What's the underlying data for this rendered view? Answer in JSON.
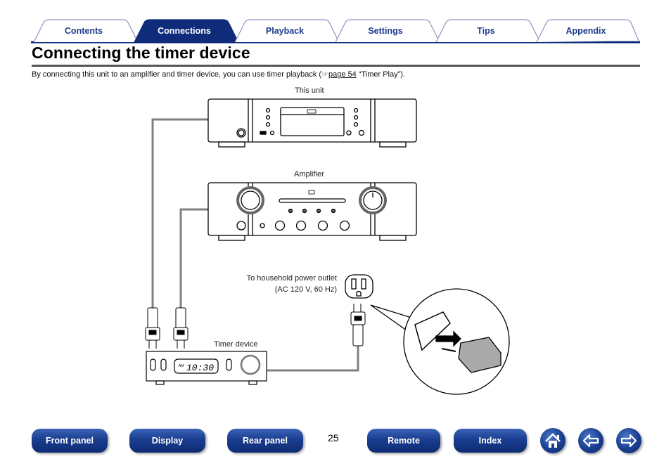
{
  "tabs": [
    {
      "label": "Contents",
      "active": false
    },
    {
      "label": "Connections",
      "active": true
    },
    {
      "label": "Playback",
      "active": false
    },
    {
      "label": "Settings",
      "active": false
    },
    {
      "label": "Tips",
      "active": false
    },
    {
      "label": "Appendix",
      "active": false
    }
  ],
  "colors": {
    "brand": "#1c3a8c",
    "tab_active": "#0e2c7a",
    "cable": "#808080"
  },
  "page": {
    "title": "Connecting the timer device",
    "intro_before": "By connecting this unit to an amplifier and timer device, you can use timer playback (",
    "intro_ref_icon": "reference-hand-icon",
    "intro_link": "page 54",
    "intro_after": " “Timer Play”).",
    "page_number": "25"
  },
  "diagram": {
    "this_unit_label": "This unit",
    "amplifier_label": "Amplifier",
    "outlet_label_line1": "To household power outlet",
    "outlet_label_line2": "(AC 120 V, 60 Hz)",
    "timer_label": "Timer device",
    "timer_display_am": "AM",
    "timer_display_time": "10:30"
  },
  "footer": {
    "buttons": [
      "Front panel",
      "Display",
      "Rear panel",
      "Remote",
      "Index"
    ],
    "icons": [
      "home-icon",
      "back-arrow-icon",
      "forward-arrow-icon"
    ]
  }
}
